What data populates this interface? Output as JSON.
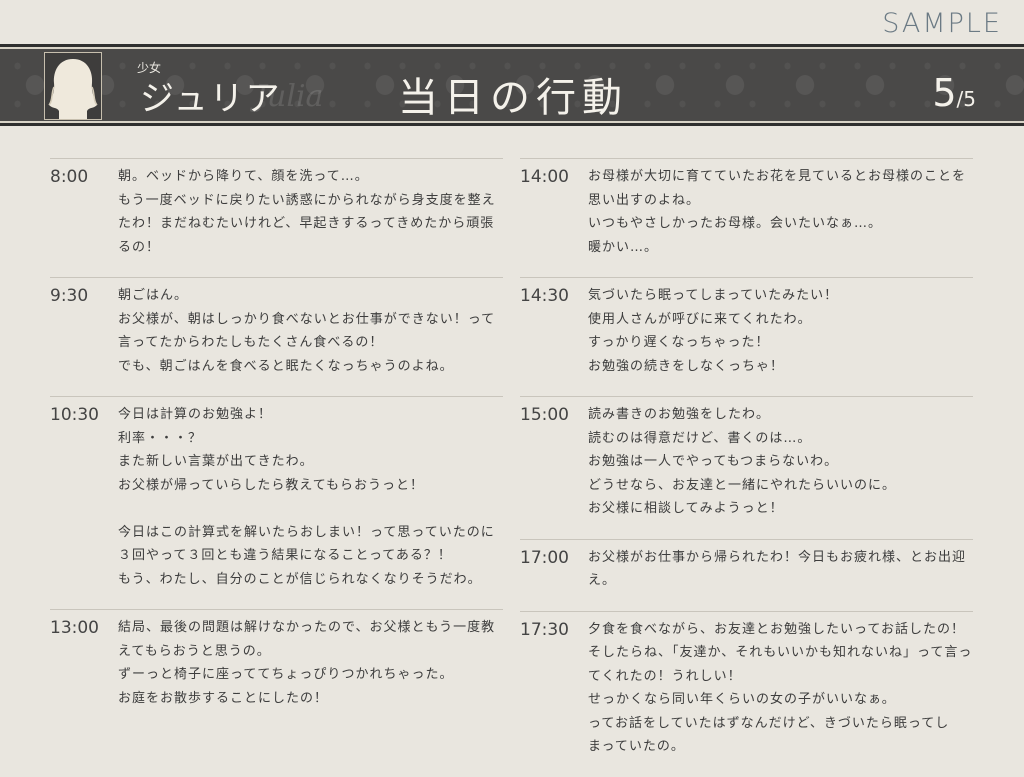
{
  "watermark": "SAMPLE",
  "header": {
    "subtitle": "少女",
    "name": "ジュリア",
    "name_latin": "Julia",
    "title": "当日の行動",
    "page_current": "5",
    "page_total": "/5"
  },
  "left_entries": [
    {
      "time": "8:00",
      "lines": [
        "朝。ベッドから降りて、顔を洗って…。",
        "もう一度ベッドに戻りたい誘惑にかられながら身支度を整え",
        "たわ！まだねむたいけれど、早起きするってきめたから頑張",
        "るの！"
      ]
    },
    {
      "time": "9:30",
      "lines": [
        "朝ごはん。",
        "お父様が、朝はしっかり食べないとお仕事ができない！って",
        "言ってたからわたしもたくさん食べるの！",
        "でも、朝ごはんを食べると眠たくなっちゃうのよね。"
      ]
    },
    {
      "time": "10:30",
      "lines": [
        "今日は計算のお勉強よ！",
        "利率・・・？",
        "また新しい言葉が出てきたわ。",
        "お父様が帰っていらしたら教えてもらおうっと！",
        "",
        "今日はこの計算式を解いたらおしまい！って思っていたのに",
        "３回やって３回とも違う結果になることってある？！",
        "もう、わたし、自分のことが信じられなくなりそうだわ。"
      ]
    },
    {
      "time": "13:00",
      "lines": [
        "結局、最後の問題は解けなかったので、お父様ともう一度教",
        "えてもらおうと思うの。",
        "ずーっと椅子に座っててちょっぴりつかれちゃった。",
        "お庭をお散歩することにしたの！"
      ]
    }
  ],
  "right_entries": [
    {
      "time": "14:00",
      "lines": [
        "お母様が大切に育てていたお花を見ているとお母様のことを",
        "思い出すのよね。",
        "いつもやさしかったお母様。会いたいなぁ…。",
        "暖かい…。"
      ]
    },
    {
      "time": "14:30",
      "lines": [
        "気づいたら眠ってしまっていたみたい！",
        "使用人さんが呼びに来てくれたわ。",
        "すっかり遅くなっちゃった！",
        "お勉強の続きをしなくっちゃ！"
      ]
    },
    {
      "time": "15:00",
      "lines": [
        "読み書きのお勉強をしたわ。",
        "読むのは得意だけど、書くのは…。",
        "お勉強は一人でやってもつまらないわ。",
        "どうせなら、お友達と一緒にやれたらいいのに。",
        "お父様に相談してみようっと！"
      ]
    },
    {
      "time": "17:00",
      "lines": [
        "お父様がお仕事から帰られたわ！今日もお疲れ様、とお出迎え。"
      ]
    },
    {
      "time": "17:30",
      "lines": [
        "夕食を食べながら、お友達とお勉強したいってお話したの！",
        "そしたらね、「友達か、それもいいかも知れないね」って言っ",
        "てくれたの！うれしい！",
        "せっかくなら同い年くらいの女の子がいいなぁ。",
        "ってお話をしていたはずなんだけど、きづいたら眠ってし",
        "まっていたの。"
      ]
    }
  ]
}
